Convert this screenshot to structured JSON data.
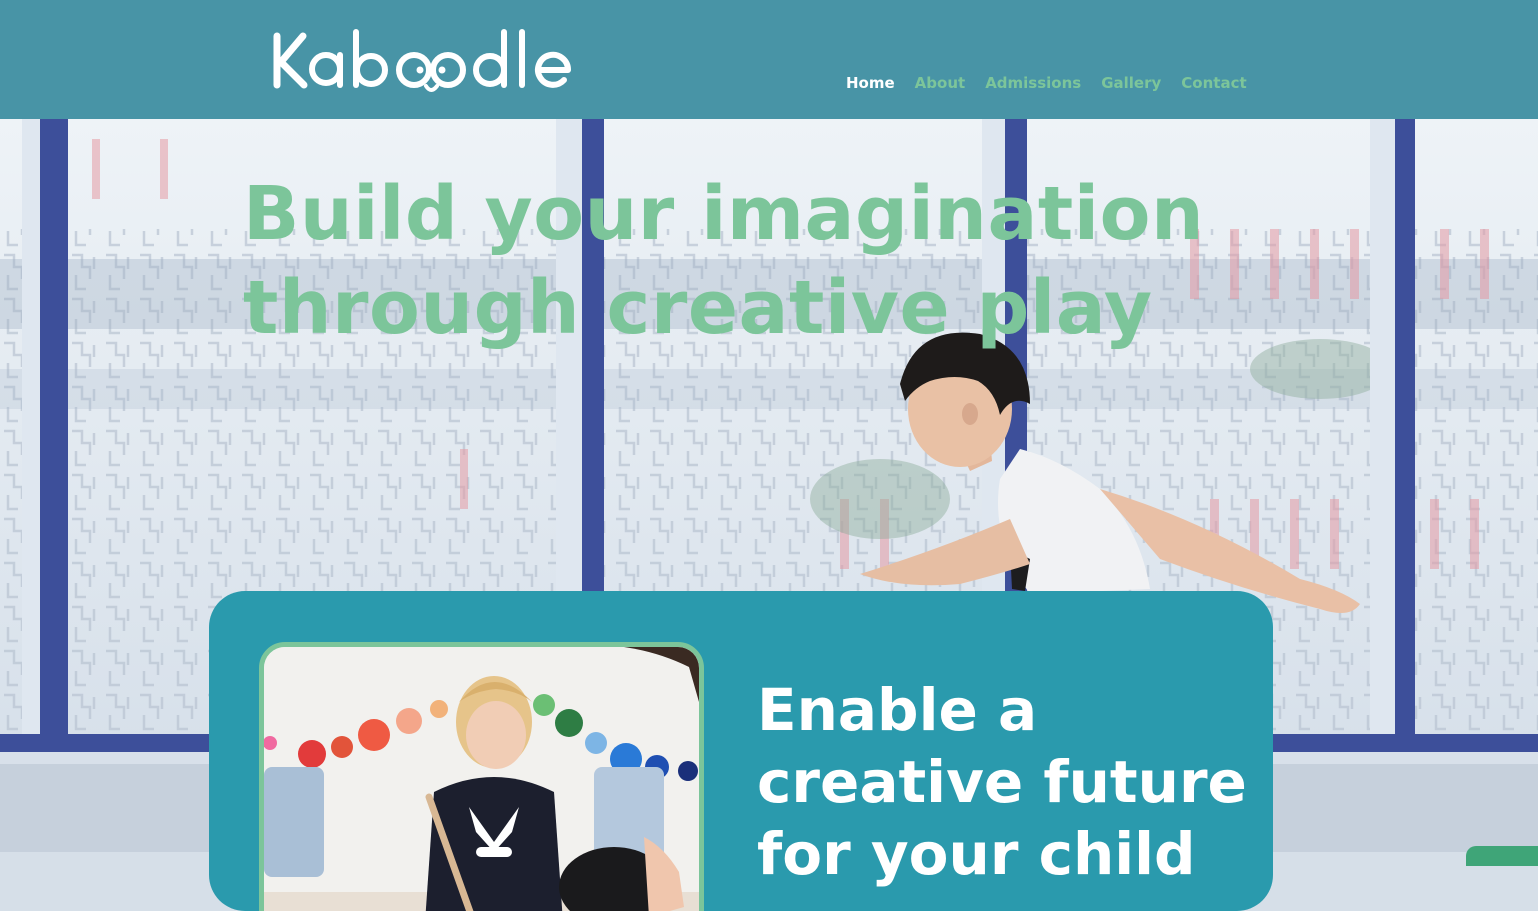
{
  "header": {
    "logo_text": "Kaboodle",
    "nav": [
      {
        "label": "Home",
        "active": true
      },
      {
        "label": "About",
        "active": false
      },
      {
        "label": "Admissions",
        "active": false
      },
      {
        "label": "Gallery",
        "active": false
      },
      {
        "label": "Contact",
        "active": false
      }
    ]
  },
  "hero": {
    "title": "Build your imagination through creative play",
    "image": "child-playing-by-window-photo"
  },
  "card": {
    "image": "toddler-playing-drum-photo",
    "heading": "Enable a creative future for your child"
  },
  "colors": {
    "header_bg": "#4894a6",
    "accent_green": "#7cc59a",
    "card_bg": "#2a9aad",
    "white": "#ffffff"
  }
}
